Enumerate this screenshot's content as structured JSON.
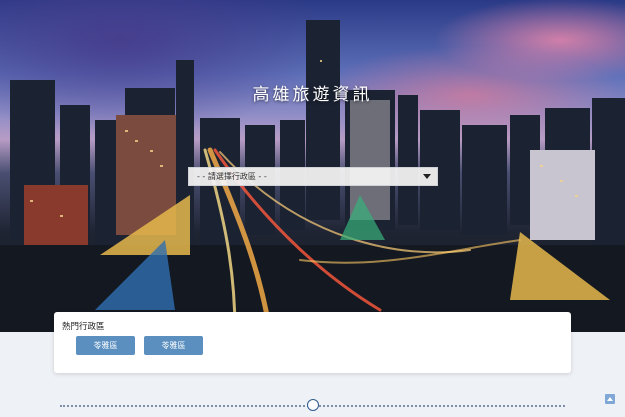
{
  "page": {
    "title": "高雄旅遊資訊"
  },
  "district_select": {
    "selected": "- - 請選擇行政區 - -",
    "icon": "chevron-down-icon"
  },
  "popular_districts": {
    "heading": "熱門行政區",
    "buttons": [
      {
        "label": "苓雅區"
      },
      {
        "label": "苓雅區"
      }
    ]
  },
  "colors": {
    "button": "#5a8fbf",
    "pager": "#2d5a8f",
    "back_to_top": "#7fa8d6"
  },
  "back_to_top": {
    "icon": "arrow-up-icon"
  }
}
